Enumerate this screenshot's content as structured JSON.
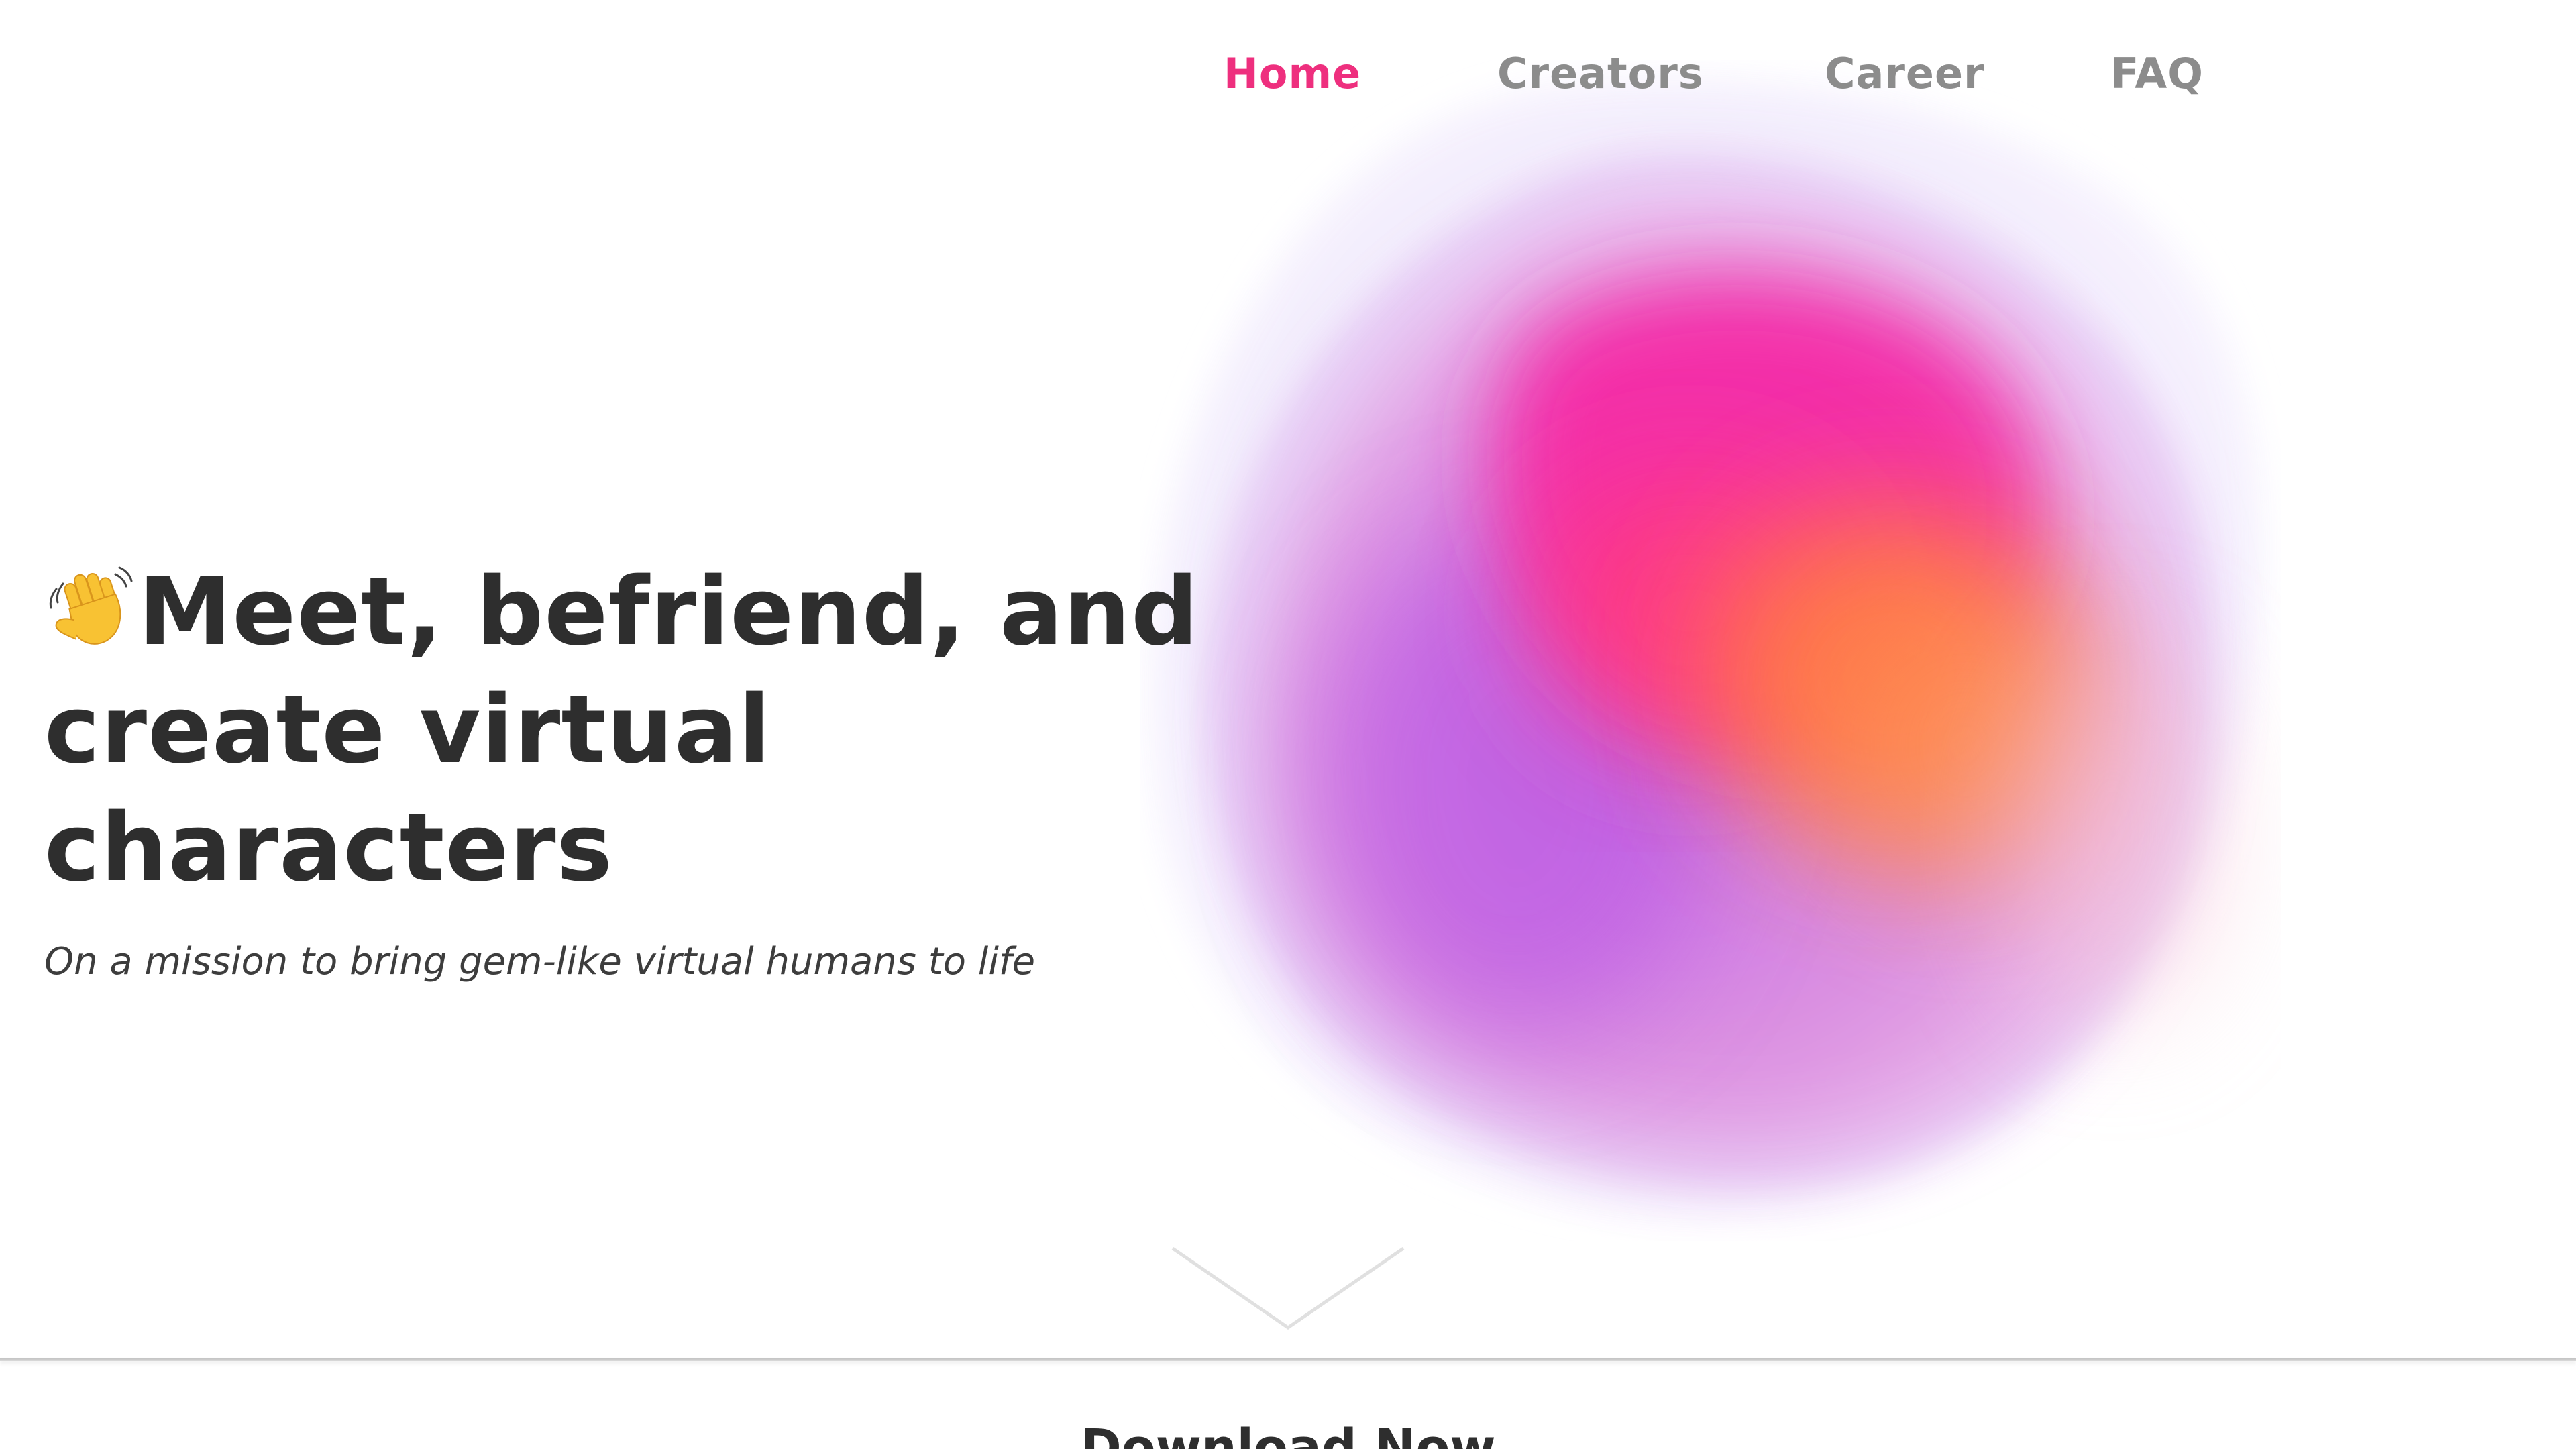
{
  "nav": {
    "items": [
      {
        "label": "Home",
        "active": true
      },
      {
        "label": "Creators",
        "active": false
      },
      {
        "label": "Career",
        "active": false
      },
      {
        "label": "FAQ",
        "active": false
      }
    ]
  },
  "hero": {
    "title_line1": "Meet, befriend, and",
    "title_line2": "create virtual characters",
    "subtitle": "On a mission to bring gem-like virtual humans to life",
    "wave_icon": "waving-hand-icon"
  },
  "scroll": {
    "icon": "chevron-down-icon"
  },
  "download": {
    "heading": "Download Now"
  },
  "colors": {
    "accent": "#ee2f7e",
    "nav_inactive": "#8c8c8c",
    "heading_text": "#2e2e2e",
    "blob_pink": "#f52ba8",
    "blob_orange": "#ff7a45",
    "blob_purple": "#b44fe0",
    "blob_lavender": "#ece4fb"
  }
}
